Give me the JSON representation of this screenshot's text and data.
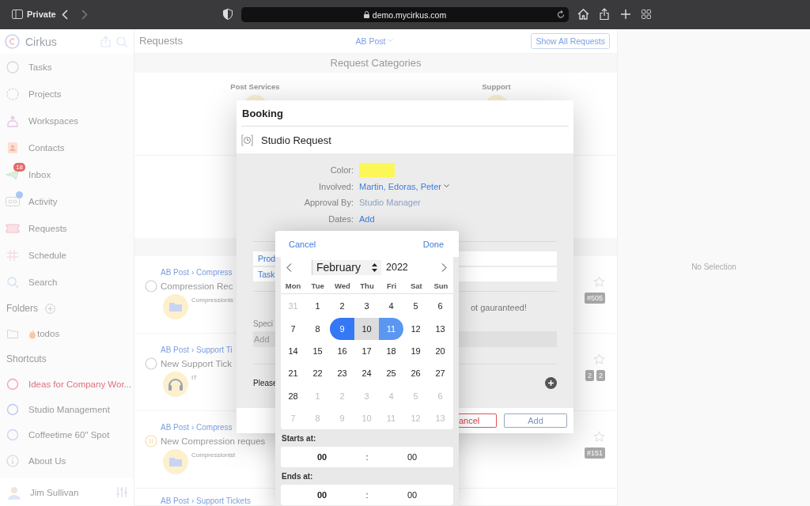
{
  "browser": {
    "mode_label": "Private",
    "url": "demo.mycirkus.com"
  },
  "sidebar": {
    "app_name": "Cirkus",
    "items": [
      {
        "label": "Tasks",
        "dot": false
      },
      {
        "label": "Projects",
        "dot": false
      },
      {
        "label": "Workspaces",
        "dot": false
      },
      {
        "label": "Contacts",
        "dot": false
      },
      {
        "label": "Inbox",
        "badge": "18",
        "dot": false
      },
      {
        "label": "Activity",
        "dot": true
      },
      {
        "label": "Requests",
        "dot": false
      },
      {
        "label": "Schedule",
        "dot": false
      },
      {
        "label": "Search",
        "dot": false
      }
    ],
    "folders_title": "Folders",
    "folders": [
      {
        "label": "todos"
      }
    ],
    "shortcuts_title": "Shortcuts",
    "shortcuts": [
      {
        "label": "Ideas for Company Wor...",
        "color": "#f4a7ae",
        "alert": true
      },
      {
        "label": "Studio Management",
        "color": "#b9c9ef",
        "alert": false
      },
      {
        "label": "Coffeetime 60\" Spot",
        "color": "#c9d6f2",
        "alert": false
      }
    ],
    "about": "About Us",
    "user": "Jim Sullivan"
  },
  "main": {
    "title": "Requests",
    "filter": "AB Post",
    "show_all": "Show All Requests",
    "categories_title": "Request Categories",
    "categories": [
      "Post Services",
      "Support"
    ],
    "rows": [
      {
        "breadcrumb": "AB Post › Compress",
        "title": "Compression Rec",
        "subtitle": "Compressionis",
        "kind": "open",
        "badges": [
          "#505"
        ]
      },
      {
        "breadcrumb": "AB Post › Support Ti",
        "title": "New Support Tick",
        "subtitle": "IT",
        "kind": "open",
        "badges": [
          "2",
          "2"
        ]
      },
      {
        "breadcrumb": "AB Post › Compress",
        "title": "New Compression reques",
        "subtitle": "Compressionist",
        "kind": "paused",
        "badges": [
          "#151"
        ]
      },
      {
        "breadcrumb": "AB Post › Support Tickets"
      }
    ]
  },
  "detail": {
    "empty": "No Selection"
  },
  "modal": {
    "title": "Booking",
    "request": "Studio Request",
    "fields": [
      {
        "label": "Color:",
        "kind": "swatch",
        "color": "#fbf757"
      },
      {
        "label": "Involved:",
        "kind": "dropdown",
        "value": "Martin, Edoras, Peter"
      },
      {
        "label": "Approval By:",
        "kind": "muted",
        "value": "Studio Manager"
      },
      {
        "label": "Dates:",
        "kind": "link",
        "value": "Add"
      }
    ],
    "links": [
      "Prod",
      "Task"
    ],
    "note": "ot gauranteed!",
    "special_label": "Speci",
    "special_placeholder": "Add",
    "please": "Please",
    "cancel": "ancel",
    "add": "Add"
  },
  "date_picker": {
    "cancel": "Cancel",
    "done": "Done",
    "month": "February",
    "year": "2022",
    "weekdays": [
      "Mon",
      "Tue",
      "Wed",
      "Thu",
      "Fri",
      "Sat",
      "Sun"
    ],
    "days": [
      {
        "label": "31",
        "muted": true,
        "selected": false
      },
      {
        "label": "1",
        "muted": false,
        "selected": false
      },
      {
        "label": "2",
        "muted": false,
        "selected": false
      },
      {
        "label": "3",
        "muted": false,
        "selected": false
      },
      {
        "label": "4",
        "muted": false,
        "selected": false
      },
      {
        "label": "5",
        "muted": false,
        "selected": false
      },
      {
        "label": "6",
        "muted": false,
        "selected": false
      },
      {
        "label": "7",
        "muted": false,
        "selected": false
      },
      {
        "label": "8",
        "muted": false,
        "selected": false
      },
      {
        "label": "9",
        "muted": false,
        "selected": true
      },
      {
        "label": "10",
        "muted": false,
        "selected": true
      },
      {
        "label": "11",
        "muted": false,
        "selected": true
      },
      {
        "label": "12",
        "muted": false,
        "selected": false
      },
      {
        "label": "13",
        "muted": false,
        "selected": false
      },
      {
        "label": "14",
        "muted": false,
        "selected": false
      },
      {
        "label": "15",
        "muted": false,
        "selected": false
      },
      {
        "label": "16",
        "muted": false,
        "selected": false
      },
      {
        "label": "17",
        "muted": false,
        "selected": false
      },
      {
        "label": "18",
        "muted": false,
        "selected": false
      },
      {
        "label": "19",
        "muted": false,
        "selected": false
      },
      {
        "label": "20",
        "muted": false,
        "selected": false
      },
      {
        "label": "21",
        "muted": false,
        "selected": false
      },
      {
        "label": "22",
        "muted": false,
        "selected": false
      },
      {
        "label": "23",
        "muted": false,
        "selected": false
      },
      {
        "label": "24",
        "muted": false,
        "selected": false
      },
      {
        "label": "25",
        "muted": false,
        "selected": false
      },
      {
        "label": "26",
        "muted": false,
        "selected": false
      },
      {
        "label": "27",
        "muted": false,
        "selected": false
      },
      {
        "label": "28",
        "muted": false,
        "selected": false
      },
      {
        "label": "1",
        "muted": true,
        "selected": false
      },
      {
        "label": "2",
        "muted": true,
        "selected": false
      },
      {
        "label": "3",
        "muted": true,
        "selected": false
      },
      {
        "label": "4",
        "muted": true,
        "selected": false
      },
      {
        "label": "5",
        "muted": true,
        "selected": false
      },
      {
        "label": "6",
        "muted": true,
        "selected": false
      },
      {
        "label": "7",
        "muted": true,
        "selected": false
      },
      {
        "label": "8",
        "muted": true,
        "selected": false
      },
      {
        "label": "9",
        "muted": true,
        "selected": false
      },
      {
        "label": "10",
        "muted": true,
        "selected": false
      },
      {
        "label": "11",
        "muted": true,
        "selected": false
      },
      {
        "label": "12",
        "muted": true,
        "selected": false
      },
      {
        "label": "13",
        "muted": true,
        "selected": false
      }
    ],
    "starts_label": "Starts at:",
    "starts": {
      "hours": "00",
      "separator": ":",
      "minutes": "00"
    },
    "ends_label": "Ends at:",
    "ends": {
      "hours": "00",
      "separator": ":",
      "minutes": "00"
    }
  }
}
